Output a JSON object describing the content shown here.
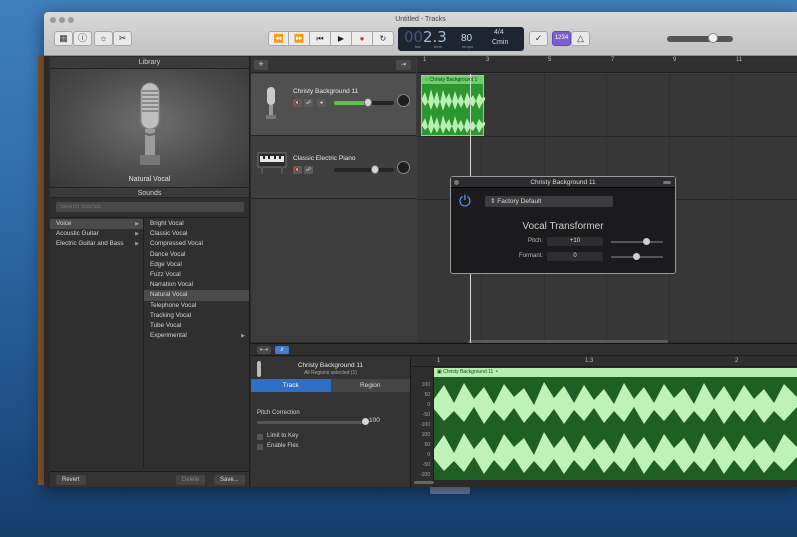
{
  "window": {
    "title": "Untitled - Tracks"
  },
  "toolbar": {
    "library_icon": "library-icon",
    "help_icon": "help-icon",
    "settings_icon": "settings-icon",
    "editors_icon": "scissors-icon",
    "transport": [
      "rewind-icon",
      "forward-icon",
      "to-start-icon",
      "play-icon",
      "record-icon",
      "cycle-icon"
    ],
    "record_color": "#e0342f",
    "lcd": {
      "bar": "00",
      "position": "2.3",
      "bar_label": "bar",
      "beat_label": "beat",
      "tempo": "80",
      "tempo_label": "tempo",
      "signature": "4/4",
      "key": "Cmin"
    },
    "tuner_icon": "tuner-icon",
    "countin": "1234",
    "metronome_icon": "metronome-icon",
    "master_volume": 0.72
  },
  "library": {
    "title": "Library",
    "selected_patch": "Natural Vocal",
    "sounds_label": "Sounds",
    "search_placeholder": "Search Sounds",
    "categories": [
      "Voice",
      "Acoustic Guitar",
      "Electric Guitar and Bass"
    ],
    "selected_category": "Voice",
    "patches": [
      "Bright Vocal",
      "Classic Vocal",
      "Compressed Vocal",
      "Dance Vocal",
      "Edge Vocal",
      "Fuzz Vocal",
      "Narration Vocal",
      "Natural Vocal",
      "Telephone Vocal",
      "Tracking Vocal",
      "Tube Vocal",
      "Experimental"
    ],
    "revert": "Revert",
    "delete": "Delete",
    "save": "Save..."
  },
  "tracks": {
    "ruler": [
      "1",
      "3",
      "5",
      "7",
      "9",
      "11"
    ],
    "list": [
      {
        "name": "Christy Background 11",
        "icon": "microphone-icon",
        "volume": 0.57
      },
      {
        "name": "Classic Electric Piano",
        "icon": "piano-icon",
        "volume": 0.7
      }
    ],
    "region_name": "Christy Background 1",
    "region_color": "#2d9630"
  },
  "plugin": {
    "title": "Christy Background 11",
    "preset": "Factory Default",
    "name": "Vocal Transformer",
    "pitch_label": "Pitch:",
    "pitch_value": "+10",
    "formant_label": "Formant:",
    "formant_value": "0"
  },
  "editor": {
    "track_name": "Christy Background 11",
    "subtitle": "All Regions selected (1)",
    "tab_track": "Track",
    "tab_region": "Region",
    "pitch_correction_label": "Pitch Correction",
    "pitch_correction_value": "100",
    "limit_to_key": "Limit to Key",
    "enable_flex": "Enable Flex",
    "ruler": [
      "1",
      "1.3",
      "2"
    ],
    "scale": [
      "100",
      "50",
      "0",
      "-50",
      "-100",
      "100",
      "50",
      "0",
      "-50",
      "-100"
    ],
    "region_name": "Christy Background 11"
  }
}
